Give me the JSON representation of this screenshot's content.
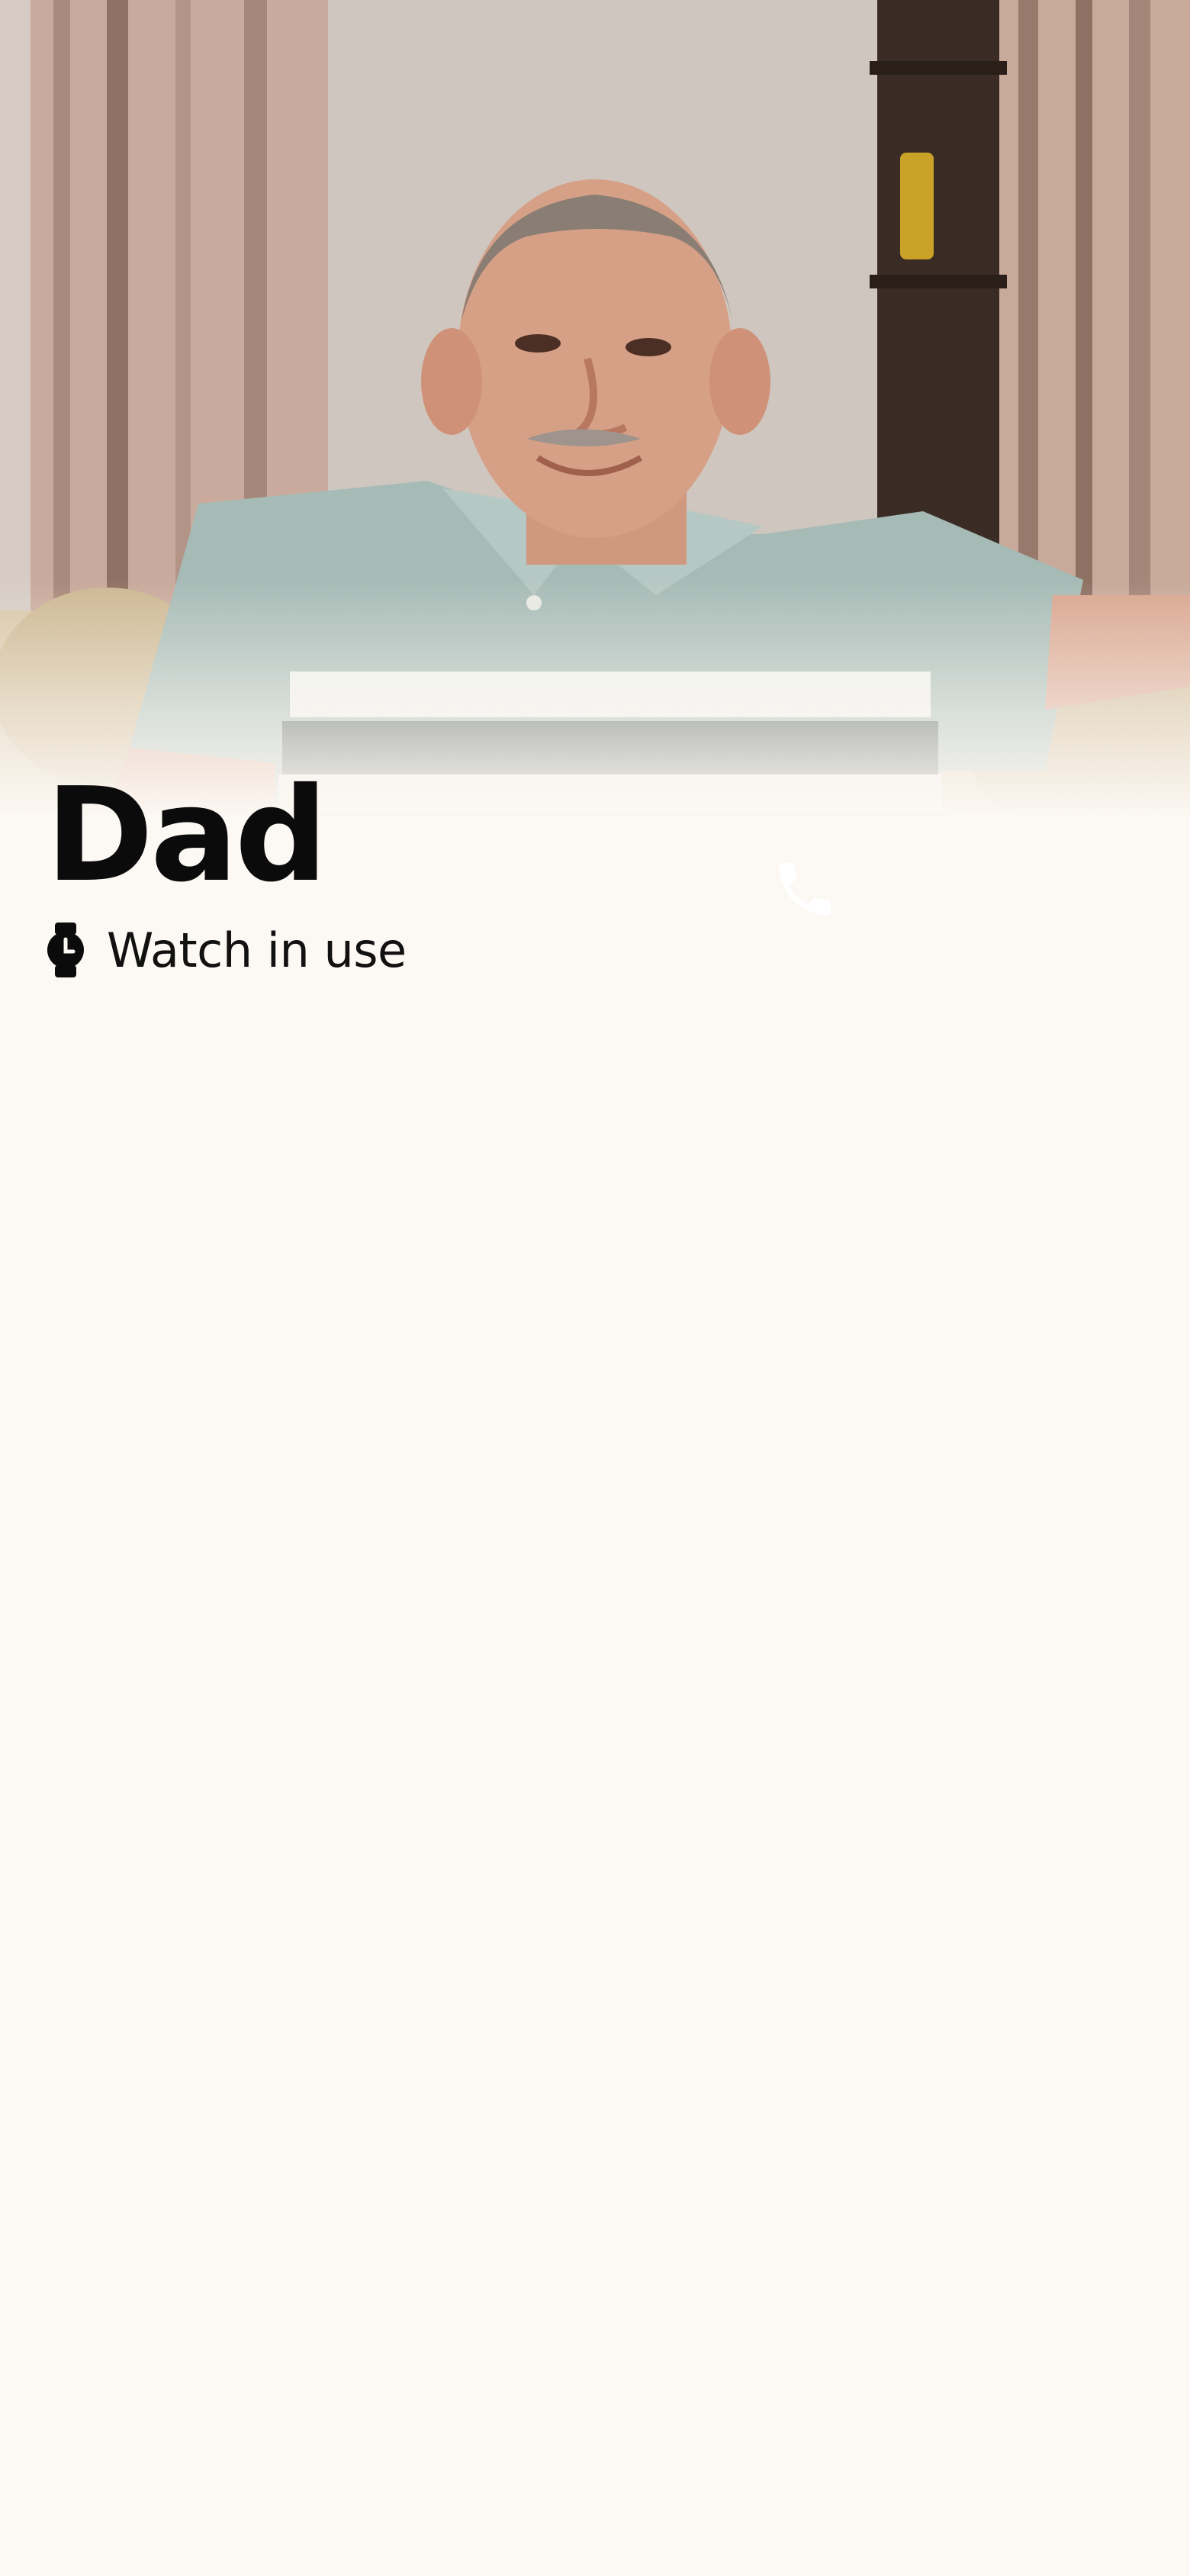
{
  "contact": {
    "name": "Dad",
    "status": "Watch in use",
    "status_icon": "watch-icon",
    "call_icon": "phone-icon",
    "photo_description": "smiling elderly man"
  },
  "colors": {
    "background": "#fcf8f3",
    "text": "#0b0b0b",
    "call_icon": "#ffffff"
  }
}
